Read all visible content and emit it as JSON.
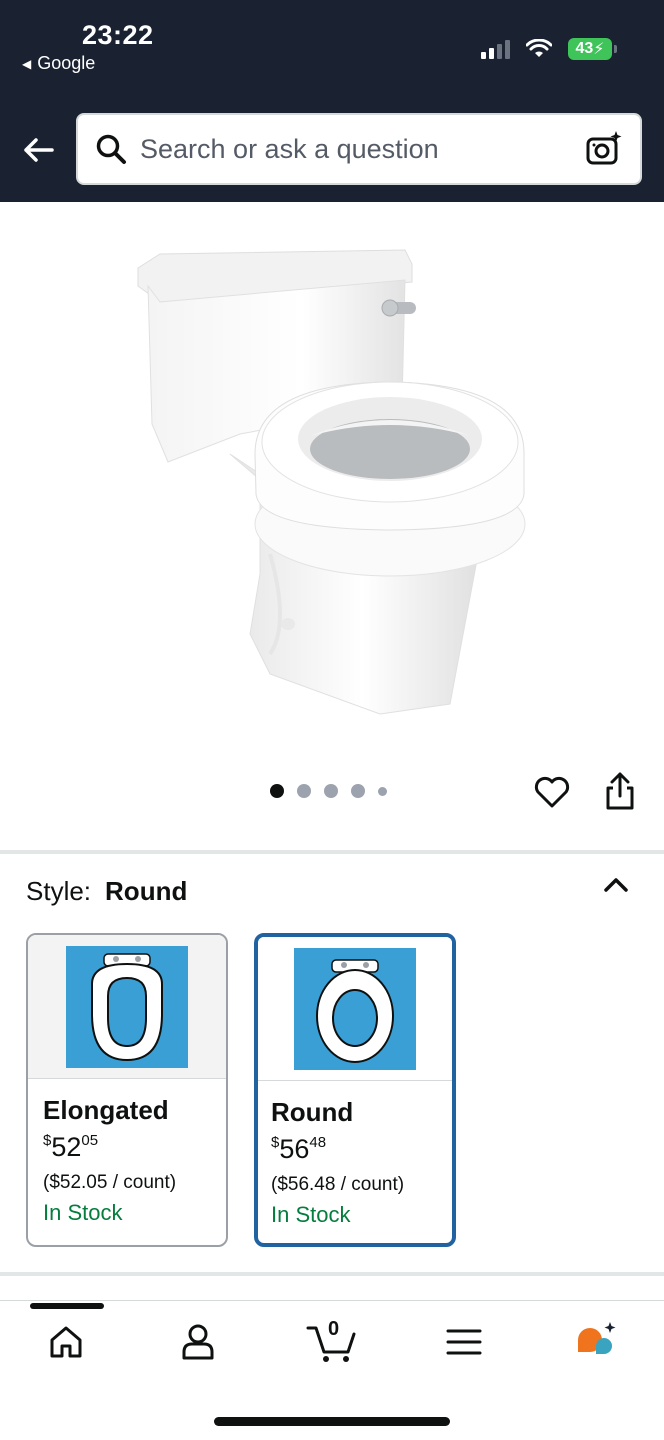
{
  "status_bar": {
    "time": "23:22",
    "back_app": "Google",
    "battery": "43"
  },
  "search": {
    "placeholder": "Search or ask a question"
  },
  "image_carousel": {
    "dot_count": 5,
    "active_index": 0
  },
  "style_selector": {
    "label": "Style:",
    "selected": "Round",
    "options": [
      {
        "name": "Elongated",
        "price_whole": "52",
        "price_fraction": "05",
        "currency": "$",
        "unit_price": "($52.05 / count)",
        "stock": "In Stock",
        "selected": false
      },
      {
        "name": "Round",
        "price_whole": "56",
        "price_fraction": "48",
        "currency": "$",
        "unit_price": "($56.48 / count)",
        "stock": "In Stock",
        "selected": true
      }
    ]
  },
  "bottom_nav": {
    "cart_count": "0",
    "items": [
      "home-icon",
      "account-icon",
      "cart-icon",
      "menu-icon",
      "rufus-icon"
    ]
  },
  "colors": {
    "header_bg": "#1a2231",
    "selected_border": "#2162a1",
    "in_stock": "#067d3f",
    "battery": "#3fc45a",
    "seat_bg": "#3a9fd5"
  }
}
